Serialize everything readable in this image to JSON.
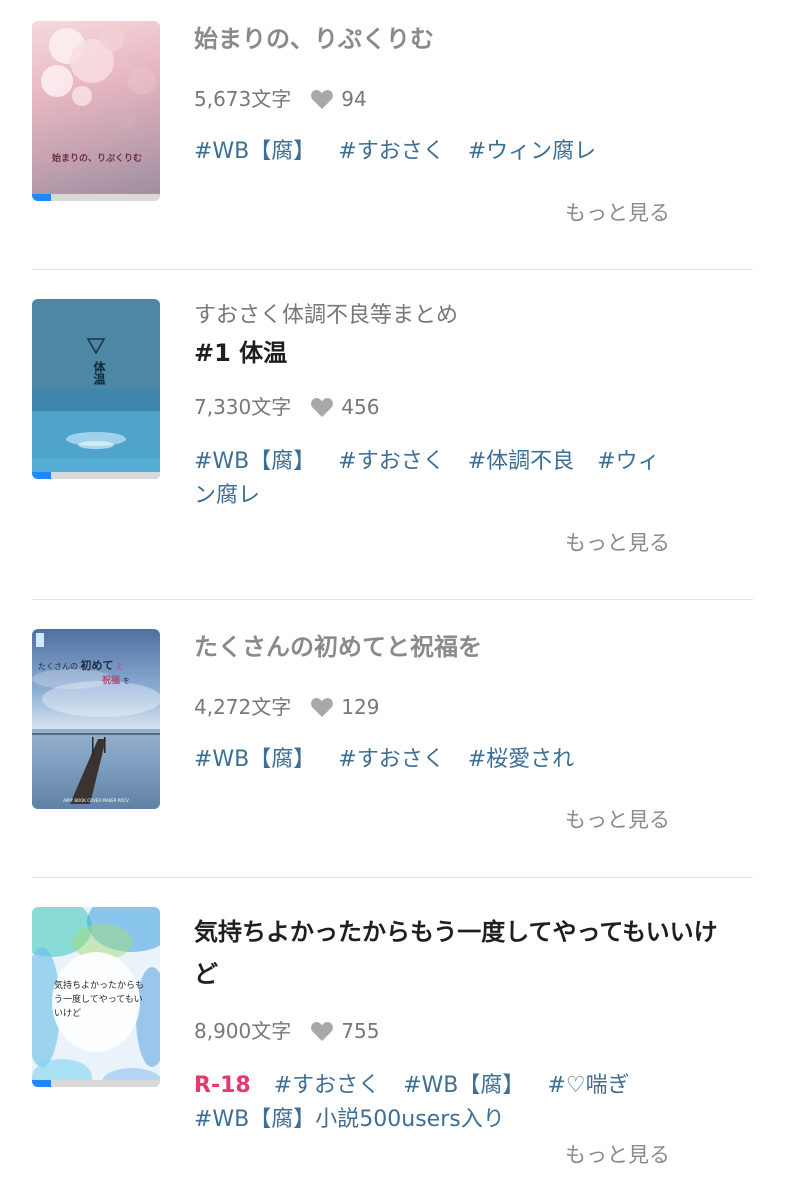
{
  "works": [
    {
      "series": "",
      "title": "始まりの、りぷくりむ",
      "cover_text": "始まりの、りぷくりむ",
      "chars": "5,673文字",
      "likes": "94",
      "tags": [
        "#WB【腐】",
        "#すおさく",
        "#ウィン腐レ"
      ],
      "more": "もっと見る",
      "progress": 0.15
    },
    {
      "series": "すおさく体調不良等まとめ",
      "title": "#1 体温",
      "cover_text": "体温",
      "chars": "7,330文字",
      "likes": "456",
      "tags": [
        "#WB【腐】",
        "#すおさく",
        "#体調不良",
        "#ウィン腐レ"
      ],
      "more": "もっと見る",
      "progress": 0.15
    },
    {
      "series": "",
      "title": "たくさんの初めてと祝福を",
      "cover_text_1": "たくさんの",
      "cover_text_2": "初めて",
      "cover_text_3": "と",
      "cover_text_4": "祝福",
      "cover_text_5": "を",
      "cover_footer": "APPY BOOK COVER MAKER POCV",
      "chars": "4,272文字",
      "likes": "129",
      "tags": [
        "#WB【腐】",
        "#すおさく",
        "#桜愛され"
      ],
      "more": "もっと見る",
      "progress": 0
    },
    {
      "series": "",
      "title": "気持ちよかったからもう一度してやってもいいけど",
      "cover_text": "気持ちよかったからもう一度してやってもいいけど",
      "chars": "8,900文字",
      "likes": "755",
      "badge": "R-18",
      "tags": [
        "#すおさく",
        "#WB【腐】",
        "#♡喘ぎ",
        "#WB【腐】小説500users入り"
      ],
      "more": "もっと見る",
      "progress": 0.15
    }
  ],
  "colors": {
    "accent": "#1e88ff",
    "tag": "#3d6e93",
    "r18": "#e6396b"
  }
}
